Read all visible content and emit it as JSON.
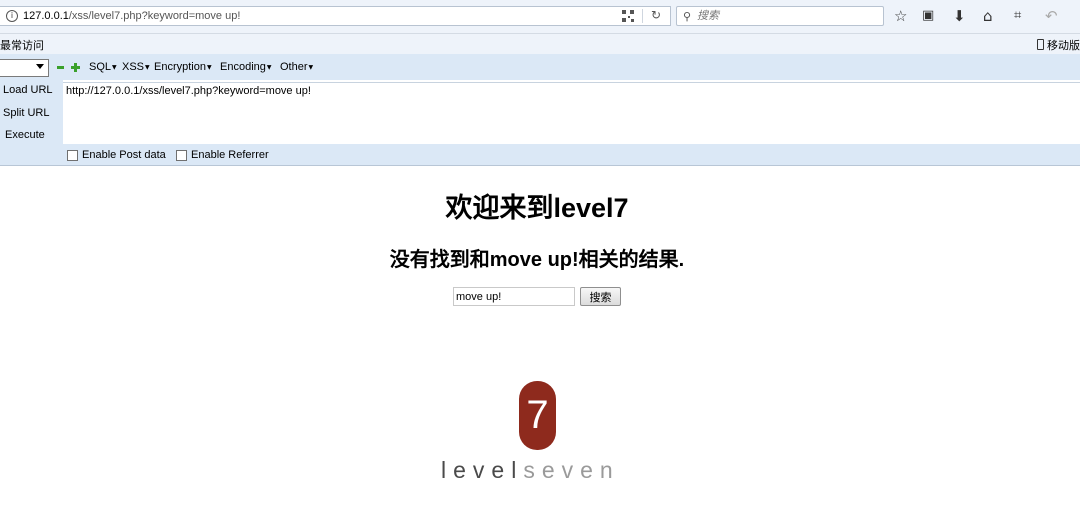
{
  "browser": {
    "url_host": "127.0.0.1",
    "url_path": "/xss/level7.php?keyword=move up!",
    "search_placeholder": "搜索",
    "bookmarks_left": "最常访问",
    "bookmarks_right": "移动版书签",
    "icons": [
      "info-icon",
      "qr-code-icon",
      "reload-icon",
      "search-icon",
      "star-icon",
      "reading-list-icon",
      "download-icon",
      "home-icon",
      "crop-icon",
      "back-icon"
    ]
  },
  "hackbar": {
    "menus": [
      "SQL",
      "XSS",
      "Encryption",
      "Encoding",
      "Other"
    ],
    "actions": {
      "load": "Load URL",
      "split": "Split URL",
      "execute": "Execute"
    },
    "url_value": "http://127.0.0.1/xss/level7.php?keyword=move up!",
    "options": {
      "post": "Enable Post data",
      "referrer": "Enable Referrer"
    }
  },
  "page": {
    "heading": "欢迎来到level7",
    "result_text": "没有找到和move up!相关的结果.",
    "keyword_value": "move up!",
    "search_button": "搜索"
  },
  "logo": {
    "badge": "7",
    "word_dark": "level",
    "word_light": "seven",
    "color": "#8e2a1d"
  }
}
